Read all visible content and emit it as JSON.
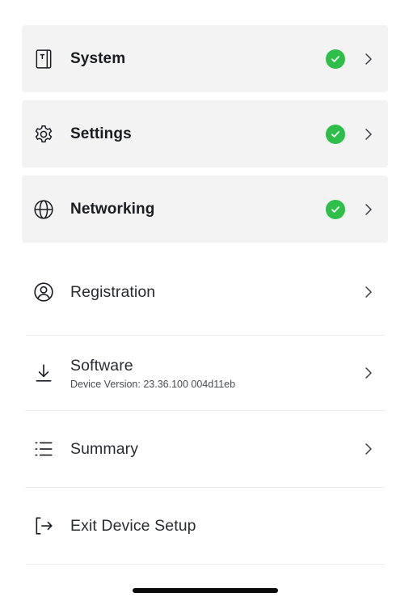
{
  "menu": {
    "system": {
      "label": "System",
      "status": "complete"
    },
    "settings": {
      "label": "Settings",
      "status": "complete"
    },
    "networking": {
      "label": "Networking",
      "status": "complete"
    },
    "registration": {
      "label": "Registration"
    },
    "software": {
      "label": "Software",
      "subtitle": "Device Version: 23.36.100 004d11eb"
    },
    "summary": {
      "label": "Summary"
    },
    "exit": {
      "label": "Exit Device Setup"
    }
  },
  "icons": {
    "system": "tablet-icon",
    "settings": "gear-icon",
    "networking": "globe-icon",
    "registration": "user-circle-icon",
    "software": "download-icon",
    "summary": "list-icon",
    "exit": "exit-icon",
    "status": "check-circle-icon",
    "chevron": "chevron-right-icon"
  },
  "colors": {
    "card_background": "#f3f3f3",
    "check_green": "#2dbf4a",
    "text": "#171a20"
  }
}
